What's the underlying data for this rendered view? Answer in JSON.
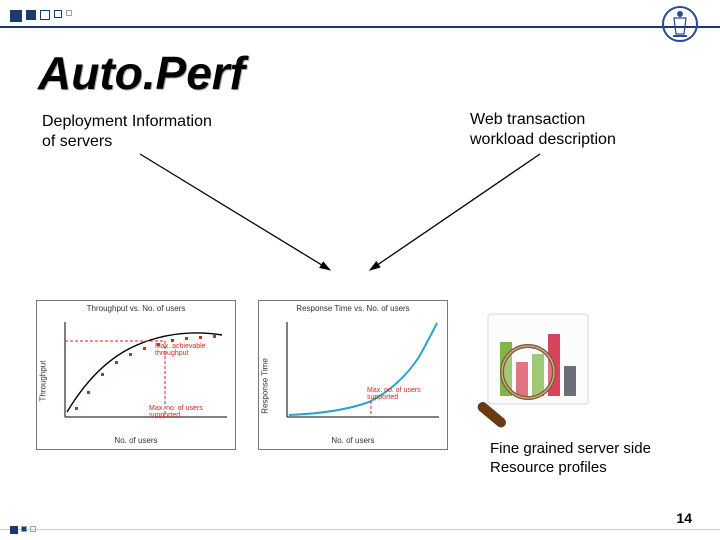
{
  "header": {
    "title": "Auto.Perf"
  },
  "inputs": {
    "left_line1": "Deployment Information",
    "left_line2": "of servers",
    "right_line1": "Web transaction",
    "right_line2": "workload description"
  },
  "outputs": {
    "profiles_line1": "Fine grained server side",
    "profiles_line2": "Resource profiles"
  },
  "page_number": "14",
  "logo_name": "institute-emblem",
  "chart_data": [
    {
      "type": "scatter",
      "title": "Throughput vs. No. of users",
      "xlabel": "No. of users",
      "ylabel": "Throughput",
      "x": [
        1,
        2,
        3,
        4,
        5,
        6,
        7,
        8,
        9,
        10,
        11
      ],
      "values": [
        5,
        18,
        32,
        42,
        50,
        56,
        60,
        63,
        65,
        66,
        66
      ],
      "xlim": [
        0,
        12
      ],
      "ylim": [
        0,
        80
      ],
      "annotations": [
        {
          "text": "Max. achievable throughput",
          "at": [
            7.5,
            60
          ]
        },
        {
          "text": "Max. no. of users supported",
          "at": [
            7.5,
            10
          ]
        }
      ],
      "guide_x": 7.5
    },
    {
      "type": "line",
      "title": "Response Time vs. No. of users",
      "xlabel": "No. of users",
      "ylabel": "Response Time",
      "x": [
        0,
        2,
        4,
        6,
        7,
        8,
        9,
        10,
        11,
        12
      ],
      "values": [
        2,
        3,
        4,
        6,
        9,
        14,
        22,
        34,
        52,
        78
      ],
      "xlim": [
        0,
        12
      ],
      "ylim": [
        0,
        90
      ],
      "annotations": [
        {
          "text": "Max. no. of users supported",
          "at": [
            7,
            30
          ]
        }
      ],
      "guide_x": 7
    }
  ],
  "bar_icon": {
    "bars": [
      {
        "h": 60,
        "color": "#7fb64a"
      },
      {
        "h": 35,
        "color": "#d6455b"
      },
      {
        "h": 45,
        "color": "#7fb64a"
      },
      {
        "h": 70,
        "color": "#d6455b"
      },
      {
        "h": 30,
        "color": "#6a6f78"
      }
    ]
  }
}
